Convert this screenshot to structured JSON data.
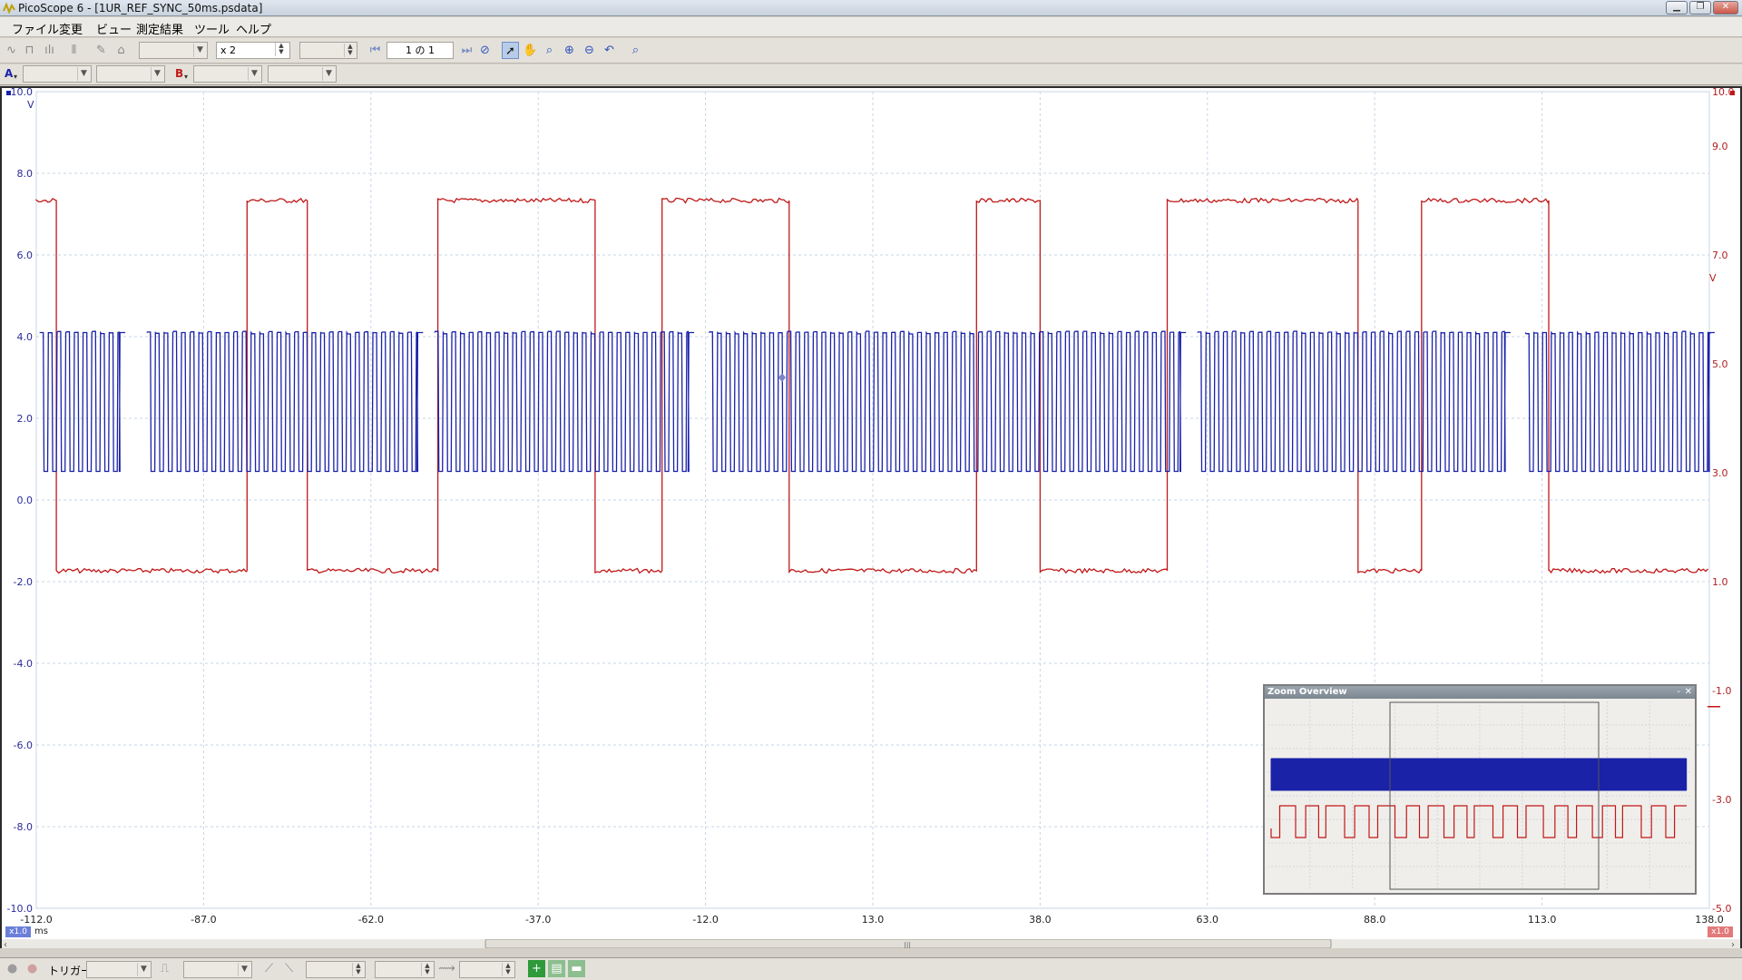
{
  "window": {
    "title": "PicoScope 6 - [1UR_REF_SYNC_50ms.psdata]",
    "minimize_label": "▁",
    "restore_label": "❐",
    "close_label": "✕"
  },
  "menu": {
    "items": [
      "ファイル",
      "変更",
      "ビュー",
      "測定結果",
      "ツール",
      "ヘルプ"
    ]
  },
  "toolbar": {
    "zoom_value": "x 2",
    "buffer_value": "1 の 1"
  },
  "channel_bar": {
    "channel_a_label": "A",
    "channel_b_label": "B"
  },
  "scope": {
    "channel_a_color": "#1a22a8",
    "channel_b_color": "#c01818",
    "left_unit": "V",
    "right_unit": "V",
    "x_unit": "ms",
    "left_axis_labels": [
      "10.0",
      "8.0",
      "6.0",
      "4.0",
      "2.0",
      "0.0",
      "-2.0",
      "-4.0",
      "-6.0",
      "-8.0",
      "-10.0"
    ],
    "right_axis_labels": [
      "10.0",
      "9.0",
      "7.0",
      "5.0",
      "3.0",
      "1.0",
      "-1.0",
      "-3.0",
      "-5.0"
    ],
    "x_axis_labels": [
      "-112.0",
      "-87.0",
      "-62.0",
      "-37.0",
      "-12.0",
      "13.0",
      "38.0",
      "63.0",
      "88.0",
      "113.0",
      "138.0"
    ],
    "left_scale_tag": "x1.0",
    "right_scale_tag": "x1.0"
  },
  "zoom_overview": {
    "title": "Zoom Overview",
    "minimize_label": "-",
    "close_label": "✕"
  },
  "bottom": {
    "trigger_label": "トリガー"
  },
  "chart_data": {
    "type": "line",
    "xlabel": "ms",
    "xlim": [
      -112.0,
      138.0
    ],
    "y_left": {
      "unit": "V",
      "range": [
        -10.0,
        10.0
      ]
    },
    "y_right": {
      "unit": "V",
      "range": [
        -5.0,
        10.0
      ]
    },
    "grid": true,
    "series": [
      {
        "channel": "A",
        "color": "#1a22a8",
        "high": 4.1,
        "low": 0.7,
        "kind": "fast square wave with gaps",
        "bursts": [
          [
            -111.5,
            -99.5
          ],
          [
            -95.5,
            -55.0
          ],
          [
            -52.5,
            -14.5
          ],
          [
            -11.5,
            59.0
          ],
          [
            61.5,
            107.5
          ],
          [
            110.5,
            138.0
          ]
        ]
      },
      {
        "channel": "B",
        "color": "#c01818",
        "high": 8.0,
        "low": 1.2,
        "kind": "slow square wave",
        "high_intervals": [
          [
            -112.0,
            -109.0
          ],
          [
            -80.5,
            -71.5
          ],
          [
            -52.0,
            -28.5
          ],
          [
            -18.5,
            0.5
          ],
          [
            28.5,
            38.0
          ],
          [
            57.0,
            85.5
          ],
          [
            95.0,
            114.0
          ]
        ]
      }
    ]
  }
}
